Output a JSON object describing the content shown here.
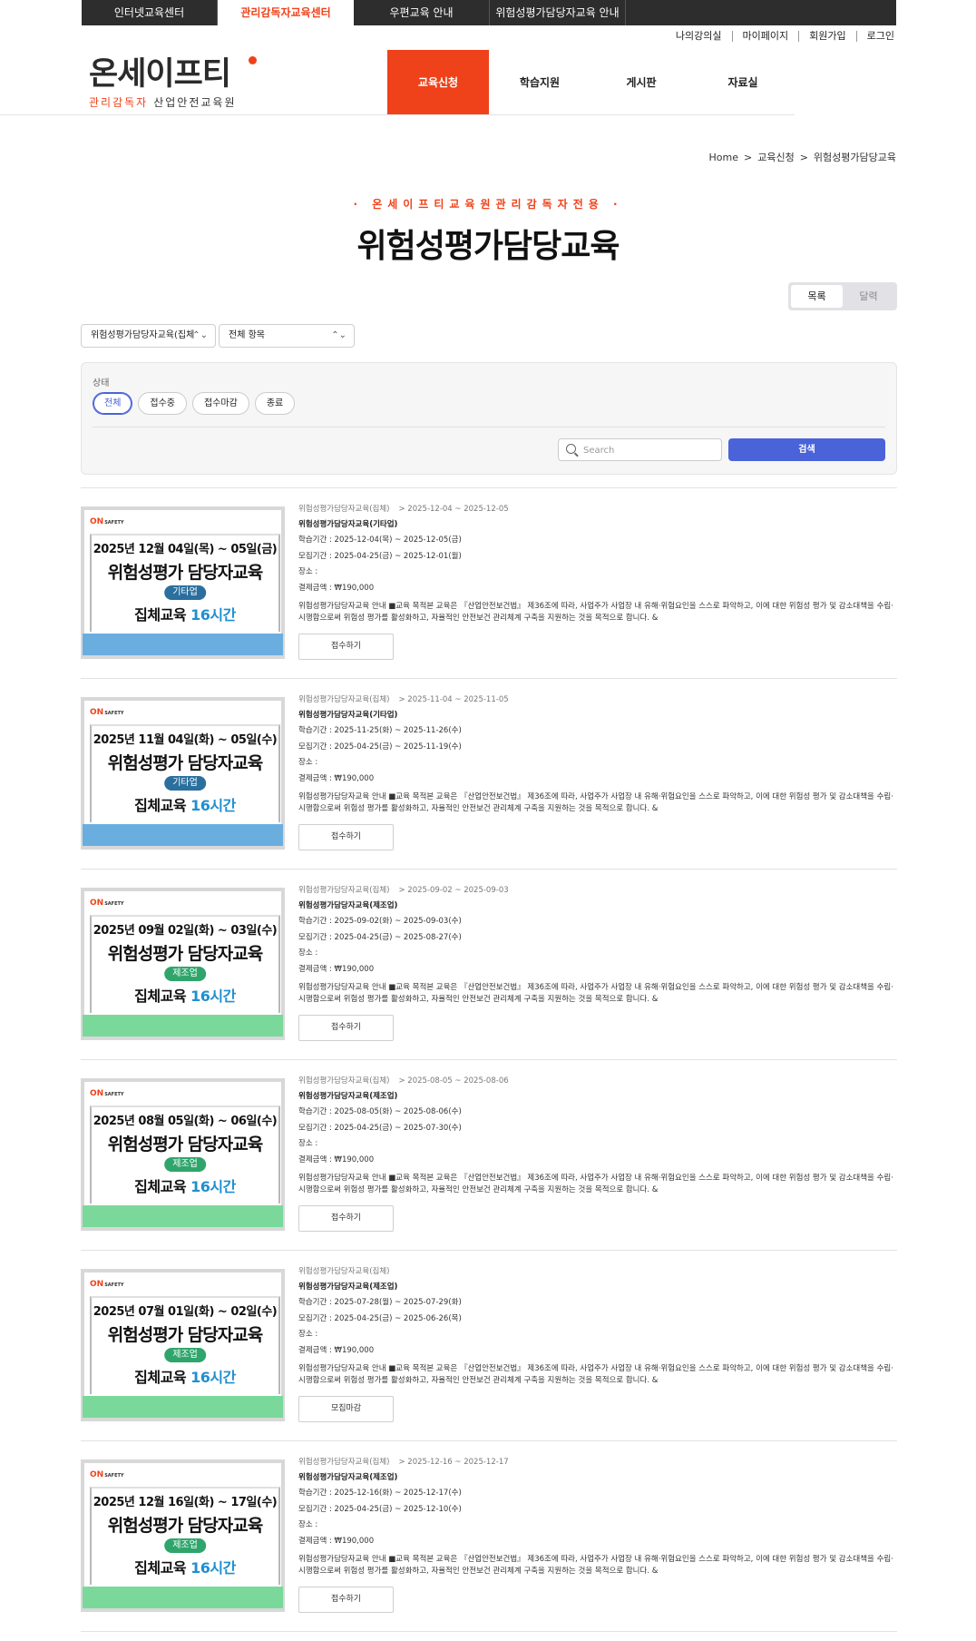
{
  "top_tabs": [
    "인터넷교육센터",
    "관리감독자교육센터",
    "우편교육 안내",
    "위험성평가담당자교육 안내"
  ],
  "util_nav": [
    "나의강의실",
    "마이페이지",
    "회원가입",
    "로그인"
  ],
  "logo": {
    "main": "온세이프티",
    "sub_orange": "관리감독자",
    "sub_dark": "산업안전교육원"
  },
  "main_nav": [
    "교육신청",
    "학습지원",
    "게시판",
    "자료실"
  ],
  "breadcrumb": [
    "Home",
    "교육신청",
    "위험성평가담당교육"
  ],
  "eyebrow": "· 온세이프티교육원관리감독자전용 ·",
  "page_title": "위험성평가담당교육",
  "view_toggle": [
    "목록",
    "달력"
  ],
  "selects": [
    "위험성평가담당자교육(집체",
    "전체 항목"
  ],
  "filter": {
    "label": "상태",
    "chips": [
      "전체",
      "접수중",
      "접수마감",
      "종료"
    ],
    "search_placeholder": "Search",
    "search_button": "검색"
  },
  "colors": {
    "accent": "#f0421a",
    "primary": "#4a63d9",
    "band_blue": "#6aaee0",
    "band_green": "#7ad99a",
    "pill_blue": "#2a6f9e",
    "pill_green": "#2fa56c"
  },
  "courses": [
    {
      "thumb": {
        "brand": "ON",
        "brand_sub": "SAFETY",
        "date": "2025년 12월 04일(목) ~ 05일(금)",
        "heading": "위험성평가 담당자교육",
        "industry": "기타업",
        "class_pre": "집체교육 ",
        "class_hl": "16시간",
        "band": "blue"
      },
      "category": "위험성평가담당자교육(집체)",
      "period": "> 2025-12-04 ~ 2025-12-05",
      "name": "위험성평가담당자교육(기타업)",
      "study": "학습기간 : 2025-12-04(목) ~ 2025-12-05(금)",
      "recruit": "모집기간 : 2025-04-25(금) ~ 2025-12-01(월)",
      "place": "장소 :",
      "price": "결제금액 : ₩190,000",
      "desc": "위험성평가담당자교육 안내 ■교육 목적본 교육은 『산업안전보건법』 제36조에 따라, 사업주가 사업장 내 유해·위험요인을 스스로 파악하고, 이에 대한 위험성 평가 및 감소대책을 수립·시행함으로써 위험성 평가를 활성화하고, 자율적인 안전보건 관리체계 구축을 지원하는 것을 목적으로 합니다. &",
      "button": "접수하기"
    },
    {
      "thumb": {
        "brand": "ON",
        "brand_sub": "SAFETY",
        "date": "2025년 11월 04일(화) ~ 05일(수)",
        "heading": "위험성평가 담당자교육",
        "industry": "기타업",
        "class_pre": "집체교육 ",
        "class_hl": "16시간",
        "band": "blue"
      },
      "category": "위험성평가담당자교육(집체)",
      "period": "> 2025-11-04 ~ 2025-11-05",
      "name": "위험성평가담당자교육(기타업)",
      "study": "학습기간 : 2025-11-25(화) ~ 2025-11-26(수)",
      "recruit": "모집기간 : 2025-04-25(금) ~ 2025-11-19(수)",
      "place": "장소 :",
      "price": "결제금액 : ₩190,000",
      "desc": "위험성평가담당자교육 안내 ■교육 목적본 교육은 『산업안전보건법』 제36조에 따라, 사업주가 사업장 내 유해·위험요인을 스스로 파악하고, 이에 대한 위험성 평가 및 감소대책을 수립·시행함으로써 위험성 평가를 활성화하고, 자율적인 안전보건 관리체계 구축을 지원하는 것을 목적으로 합니다. &",
      "button": "접수하기"
    },
    {
      "thumb": {
        "brand": "ON",
        "brand_sub": "SAFETY",
        "date": "2025년 09월 02일(화) ~ 03일(수)",
        "heading": "위험성평가 담당자교육",
        "industry": "제조업",
        "class_pre": "집체교육 ",
        "class_hl": "16시간",
        "band": "green"
      },
      "category": "위험성평가담당자교육(집체)",
      "period": "> 2025-09-02 ~ 2025-09-03",
      "name": "위험성평가담당자교육(제조업)",
      "study": "학습기간 : 2025-09-02(화) ~ 2025-09-03(수)",
      "recruit": "모집기간 : 2025-04-25(금) ~ 2025-08-27(수)",
      "place": "장소 :",
      "price": "결제금액 : ₩190,000",
      "desc": "위험성평가담당자교육 안내 ■교육 목적본 교육은 『산업안전보건법』 제36조에 따라, 사업주가 사업장 내 유해·위험요인을 스스로 파악하고, 이에 대한 위험성 평가 및 감소대책을 수립·시행함으로써 위험성 평가를 활성화하고, 자율적인 안전보건 관리체계 구축을 지원하는 것을 목적으로 합니다. &",
      "button": "접수하기"
    },
    {
      "thumb": {
        "brand": "ON",
        "brand_sub": "SAFETY",
        "date": "2025년 08월 05일(화) ~ 06일(수)",
        "heading": "위험성평가 담당자교육",
        "industry": "제조업",
        "class_pre": "집체교육 ",
        "class_hl": "16시간",
        "band": "green"
      },
      "category": "위험성평가담당자교육(집체)",
      "period": "> 2025-08-05 ~ 2025-08-06",
      "name": "위험성평가담당자교육(제조업)",
      "study": "학습기간 : 2025-08-05(화) ~ 2025-08-06(수)",
      "recruit": "모집기간 : 2025-04-25(금) ~ 2025-07-30(수)",
      "place": "장소 :",
      "price": "결제금액 : ₩190,000",
      "desc": "위험성평가담당자교육 안내 ■교육 목적본 교육은 『산업안전보건법』 제36조에 따라, 사업주가 사업장 내 유해·위험요인을 스스로 파악하고, 이에 대한 위험성 평가 및 감소대책을 수립·시행함으로써 위험성 평가를 활성화하고, 자율적인 안전보건 관리체계 구축을 지원하는 것을 목적으로 합니다. &",
      "button": "접수하기"
    },
    {
      "thumb": {
        "brand": "ON",
        "brand_sub": "SAFETY",
        "date": "2025년 07월 01일(화) ~ 02일(수)",
        "heading": "위험성평가 담당자교육",
        "industry": "제조업",
        "class_pre": "집체교육 ",
        "class_hl": "16시간",
        "band": "green"
      },
      "category": "위험성평가담당자교육(집체)",
      "period": "",
      "name": "위험성평가담당자교육(제조업)",
      "study": "학습기간 : 2025-07-28(월) ~ 2025-07-29(화)",
      "recruit": "모집기간 : 2025-04-25(금) ~ 2025-06-26(목)",
      "place": "장소 :",
      "price": "결제금액 : ₩190,000",
      "desc": "위험성평가담당자교육 안내 ■교육 목적본 교육은 『산업안전보건법』 제36조에 따라, 사업주가 사업장 내 유해·위험요인을 스스로 파악하고, 이에 대한 위험성 평가 및 감소대책을 수립·시행함으로써 위험성 평가를 활성화하고, 자율적인 안전보건 관리체계 구축을 지원하는 것을 목적으로 합니다. &",
      "button": "모집마감"
    },
    {
      "thumb": {
        "brand": "ON",
        "brand_sub": "SAFETY",
        "date": "2025년 12월 16일(화) ~ 17일(수)",
        "heading": "위험성평가 담당자교육",
        "industry": "제조업",
        "class_pre": "집체교육 ",
        "class_hl": "16시간",
        "band": "green"
      },
      "category": "위험성평가담당자교육(집체)",
      "period": "> 2025-12-16 ~ 2025-12-17",
      "name": "위험성평가담당자교육(제조업)",
      "study": "학습기간 : 2025-12-16(화) ~ 2025-12-17(수)",
      "recruit": "모집기간 : 2025-04-25(금) ~ 2025-12-10(수)",
      "place": "장소 :",
      "price": "결제금액 : ₩190,000",
      "desc": "위험성평가담당자교육 안내 ■교육 목적본 교육은 『산업안전보건법』 제36조에 따라, 사업주가 사업장 내 유해·위험요인을 스스로 파악하고, 이에 대한 위험성 평가 및 감소대책을 수립·시행함으로써 위험성 평가를 활성화하고, 자율적인 안전보건 관리체계 구축을 지원하는 것을 목적으로 합니다. &",
      "button": "접수하기"
    }
  ]
}
